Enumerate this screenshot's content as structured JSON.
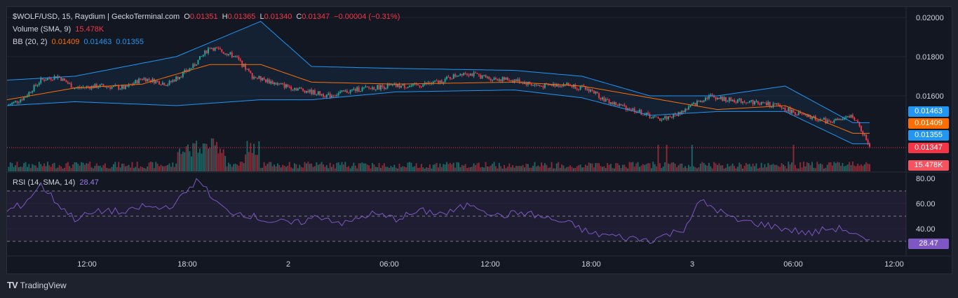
{
  "header": {
    "symbol_line": "$WOLF/USD, 15, Raydium | GeckoTerminal.com",
    "o_label": "O",
    "o_value": "0.01351",
    "h_label": "H",
    "h_value": "0.01365",
    "l_label": "L",
    "l_value": "0.01340",
    "c_label": "C",
    "c_value": "0.01347",
    "change": "−0.00004 (−0.31%)",
    "volume_label": "Volume (SMA, 9)",
    "volume_value": "15.478K",
    "bb_label": "BB (20, 2)",
    "bb_basis": "0.01409",
    "bb_upper": "0.01463",
    "bb_lower": "0.01355"
  },
  "rsi_legend": {
    "label": "RSI (14, SMA, 14)",
    "value": "28.47"
  },
  "price_tags": {
    "bb_upper": "0.01463",
    "bb_basis": "0.01409",
    "bb_lower": "0.01355",
    "last_price": "0.01347",
    "volume": "15.478K",
    "rsi": "28.47"
  },
  "footer": {
    "brand": "TradingView",
    "logo": "TV"
  },
  "colors": {
    "up": "#26a69a",
    "down": "#f23645",
    "basis": "#ff6d00",
    "band": "#2196f3",
    "rsi": "#7e57c2",
    "bg": "#131722"
  },
  "chart_data": [
    {
      "type": "candlestick",
      "title": "$WOLF/USD, 15, Raydium | GeckoTerminal.com",
      "ylim": [
        0.0147,
        0.0201
      ],
      "y_ticks": [
        "0.02000",
        "0.01800",
        "0.01600"
      ],
      "x_ticks": [
        "12:00",
        "18:00",
        "2",
        "06:00",
        "12:00",
        "18:00",
        "3",
        "06:00",
        "12:00"
      ],
      "series": [
        {
          "name": "Price",
          "points": [
            [
              0,
              0.0155
            ],
            [
              10,
              0.0159
            ],
            [
              20,
              0.0168
            ],
            [
              30,
              0.017
            ],
            [
              40,
              0.0164
            ],
            [
              55,
              0.0165
            ],
            [
              70,
              0.0164
            ],
            [
              80,
              0.0169
            ],
            [
              95,
              0.0166
            ],
            [
              110,
              0.0175
            ],
            [
              120,
              0.0185
            ],
            [
              135,
              0.018
            ],
            [
              145,
              0.017
            ],
            [
              160,
              0.0166
            ],
            [
              175,
              0.0163
            ],
            [
              190,
              0.016
            ],
            [
              205,
              0.0163
            ],
            [
              225,
              0.0165
            ],
            [
              240,
              0.0165
            ],
            [
              255,
              0.0167
            ],
            [
              270,
              0.0172
            ],
            [
              285,
              0.0169
            ],
            [
              300,
              0.0168
            ],
            [
              315,
              0.0165
            ],
            [
              330,
              0.0166
            ],
            [
              345,
              0.0163
            ],
            [
              355,
              0.0157
            ],
            [
              370,
              0.0153
            ],
            [
              385,
              0.0148
            ],
            [
              395,
              0.015
            ],
            [
              405,
              0.0155
            ],
            [
              415,
              0.016
            ],
            [
              425,
              0.0158
            ],
            [
              440,
              0.0157
            ],
            [
              455,
              0.0155
            ],
            [
              470,
              0.015
            ],
            [
              485,
              0.0147
            ],
            [
              495,
              0.0148
            ],
            [
              500,
              0.015
            ],
            [
              510,
              0.01347
            ]
          ]
        },
        {
          "name": "BB Basis",
          "points": [
            [
              0,
              0.0158
            ],
            [
              40,
              0.0164
            ],
            [
              80,
              0.0166
            ],
            [
              120,
              0.0176
            ],
            [
              150,
              0.0176
            ],
            [
              180,
              0.0167
            ],
            [
              230,
              0.0166
            ],
            [
              300,
              0.0167
            ],
            [
              340,
              0.0165
            ],
            [
              380,
              0.0159
            ],
            [
              420,
              0.0153
            ],
            [
              460,
              0.0155
            ],
            [
              500,
              0.01409
            ],
            [
              510,
              0.01409
            ]
          ]
        },
        {
          "name": "BB Upper",
          "points": [
            [
              0,
              0.0168
            ],
            [
              40,
              0.017
            ],
            [
              100,
              0.018
            ],
            [
              150,
              0.0198
            ],
            [
              180,
              0.0175
            ],
            [
              230,
              0.0174
            ],
            [
              300,
              0.0173
            ],
            [
              340,
              0.017
            ],
            [
              380,
              0.016
            ],
            [
              420,
              0.016
            ],
            [
              460,
              0.0165
            ],
            [
              500,
              0.01463
            ],
            [
              510,
              0.01463
            ]
          ]
        },
        {
          "name": "BB Lower",
          "points": [
            [
              0,
              0.0155
            ],
            [
              40,
              0.0157
            ],
            [
              100,
              0.0155
            ],
            [
              150,
              0.0158
            ],
            [
              180,
              0.0158
            ],
            [
              230,
              0.0162
            ],
            [
              300,
              0.0163
            ],
            [
              340,
              0.0159
            ],
            [
              380,
              0.015
            ],
            [
              420,
              0.0152
            ],
            [
              460,
              0.0152
            ],
            [
              500,
              0.01355
            ],
            [
              510,
              0.01355
            ]
          ]
        }
      ]
    },
    {
      "type": "line",
      "title": "RSI (14, SMA, 14)",
      "ylim": [
        25,
        85
      ],
      "y_ticks": [
        "80.00",
        "60.00",
        "40.00"
      ],
      "levels": [
        70,
        50,
        30
      ],
      "series": [
        {
          "name": "RSI",
          "points": [
            [
              0,
              54
            ],
            [
              10,
              60
            ],
            [
              20,
              75
            ],
            [
              30,
              60
            ],
            [
              40,
              48
            ],
            [
              50,
              52
            ],
            [
              60,
              55
            ],
            [
              70,
              52
            ],
            [
              80,
              58
            ],
            [
              90,
              56
            ],
            [
              100,
              60
            ],
            [
              110,
              76
            ],
            [
              115,
              79
            ],
            [
              120,
              65
            ],
            [
              130,
              54
            ],
            [
              140,
              52
            ],
            [
              155,
              46
            ],
            [
              170,
              44
            ],
            [
              185,
              50
            ],
            [
              200,
              44
            ],
            [
              215,
              52
            ],
            [
              230,
              48
            ],
            [
              245,
              54
            ],
            [
              260,
              52
            ],
            [
              275,
              60
            ],
            [
              290,
              50
            ],
            [
              305,
              53
            ],
            [
              320,
              48
            ],
            [
              335,
              43
            ],
            [
              345,
              36
            ],
            [
              355,
              35
            ],
            [
              365,
              33
            ],
            [
              380,
              31
            ],
            [
              390,
              35
            ],
            [
              400,
              40
            ],
            [
              410,
              62
            ],
            [
              420,
              55
            ],
            [
              430,
              47
            ],
            [
              445,
              44
            ],
            [
              460,
              40
            ],
            [
              475,
              36
            ],
            [
              485,
              40
            ],
            [
              495,
              40
            ],
            [
              505,
              32
            ],
            [
              510,
              28.47
            ]
          ]
        }
      ]
    }
  ]
}
